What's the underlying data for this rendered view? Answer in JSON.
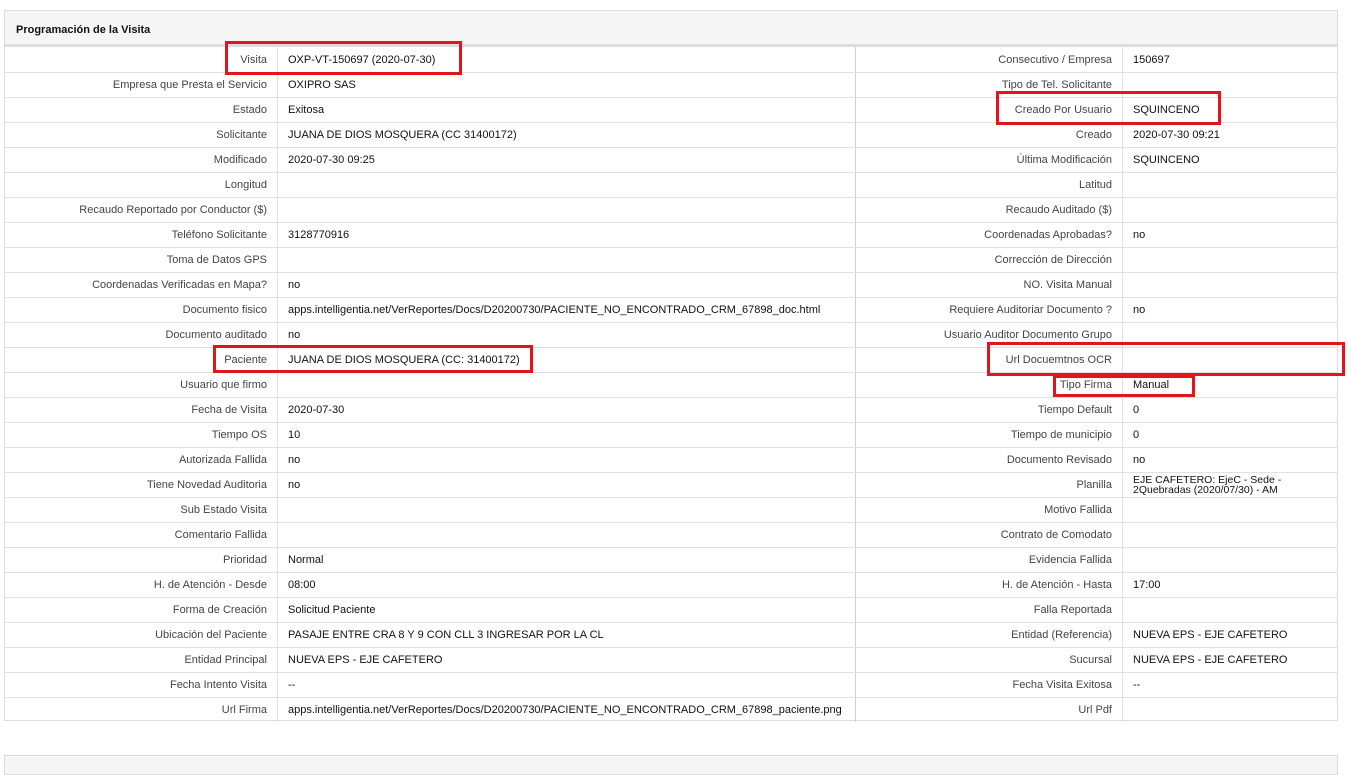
{
  "panel": {
    "title": "Programación de la Visita"
  },
  "colors": {
    "highlight": "#e3141b",
    "header_bg": "#f5f5f5",
    "border": "#e1e1e1"
  },
  "rows": [
    {
      "l1": "Visita",
      "v1": "OXP-VT-150697 (2020-07-30)",
      "l2": "Consecutivo / Empresa",
      "v2": "150697"
    },
    {
      "l1": "Empresa que Presta el Servicio",
      "v1": "OXIPRO SAS",
      "l2": "Tipo de Tel. Solicitante",
      "v2": ""
    },
    {
      "l1": "Estado",
      "v1": "Exitosa",
      "l2": "Creado Por Usuario",
      "v2": "SQUINCENO"
    },
    {
      "l1": "Solicitante",
      "v1": "JUANA DE DIOS MOSQUERA (CC 31400172)",
      "l2": "Creado",
      "v2": "2020-07-30 09:21"
    },
    {
      "l1": "Modificado",
      "v1": "2020-07-30 09:25",
      "l2": "Última Modificación",
      "v2": "SQUINCENO"
    },
    {
      "l1": "Longitud",
      "v1": "",
      "l2": "Latitud",
      "v2": ""
    },
    {
      "l1": "Recaudo Reportado por Conductor ($)",
      "v1": "",
      "l2": "Recaudo Auditado ($)",
      "v2": ""
    },
    {
      "l1": "Teléfono Solicitante",
      "v1": "3128770916",
      "l2": "Coordenadas Aprobadas?",
      "v2": "no"
    },
    {
      "l1": "Toma de Datos GPS",
      "v1": "",
      "l2": "Corrección de Dirección",
      "v2": ""
    },
    {
      "l1": "Coordenadas Verificadas en Mapa?",
      "v1": "no",
      "l2": "NO. Visita Manual",
      "v2": ""
    },
    {
      "l1": "Documento fisico",
      "v1": "apps.intelligentia.net/VerReportes/Docs/D20200730/PACIENTE_NO_ENCONTRADO_CRM_67898_doc.html",
      "l2": "Requiere Auditoriar Documento ?",
      "v2": "no"
    },
    {
      "l1": "Documento auditado",
      "v1": "no",
      "l2": "Usuario Auditor Documento Grupo",
      "v2": ""
    },
    {
      "l1": "Paciente",
      "v1": "JUANA DE DIOS MOSQUERA (CC: 31400172)",
      "l2": "Url Docuemtnos OCR",
      "v2": ""
    },
    {
      "l1": "Usuario que firmo",
      "v1": "",
      "l2": "Tipo Firma",
      "v2": "Manual"
    },
    {
      "l1": "Fecha de Visita",
      "v1": "2020-07-30",
      "l2": "Tiempo Default",
      "v2": "0"
    },
    {
      "l1": "Tiempo OS",
      "v1": "10",
      "l2": "Tiempo de municipio",
      "v2": "0"
    },
    {
      "l1": "Autorizada Fallida",
      "v1": "no",
      "l2": "Documento Revisado",
      "v2": "no"
    },
    {
      "l1": "Tiene Novedad Auditoria",
      "v1": "no",
      "l2": "Planilla",
      "v2": "EJE CAFETERO: EjeC - Sede - 2Quebradas (2020/07/30) - AM"
    },
    {
      "l1": "Sub Estado Visita",
      "v1": "",
      "l2": "Motivo Fallida",
      "v2": ""
    },
    {
      "l1": "Comentario Fallida",
      "v1": "",
      "l2": "Contrato de Comodato",
      "v2": ""
    },
    {
      "l1": "Prioridad",
      "v1": "Normal",
      "l2": "Evidencia Fallida",
      "v2": ""
    },
    {
      "l1": "H. de Atención - Desde",
      "v1": "08:00",
      "l2": "H. de Atención - Hasta",
      "v2": "17:00"
    },
    {
      "l1": "Forma de Creación",
      "v1": "Solicitud Paciente",
      "l2": "Falla Reportada",
      "v2": ""
    },
    {
      "l1": "Ubicación del Paciente",
      "v1": "PASAJE ENTRE CRA 8 Y 9 CON CLL 3 INGRESAR POR LA CL",
      "l2": "Entidad (Referencia)",
      "v2": "NUEVA EPS - EJE CAFETERO"
    },
    {
      "l1": "Entidad Principal",
      "v1": "NUEVA EPS - EJE CAFETERO",
      "l2": "Sucursal",
      "v2": "NUEVA EPS - EJE CAFETERO"
    },
    {
      "l1": "Fecha Intento Visita",
      "v1": "--",
      "l2": "Fecha Visita Exitosa",
      "v2": "--"
    },
    {
      "l1": "Url Firma",
      "v1": "apps.intelligentia.net/VerReportes/Docs/D20200730/PACIENTE_NO_ENCONTRADO_CRM_67898_paciente.png",
      "l2": "Url Pdf",
      "v2": ""
    }
  ]
}
